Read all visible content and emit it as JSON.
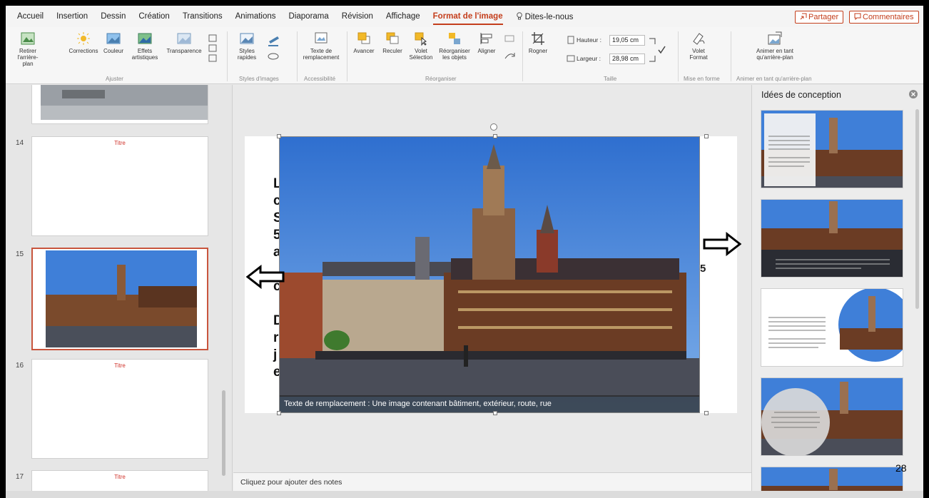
{
  "tabs": [
    "Accueil",
    "Insertion",
    "Dessin",
    "Création",
    "Transitions",
    "Animations",
    "Diaporama",
    "Révision",
    "Affichage",
    "Format de l'image",
    "Dites-le-nous"
  ],
  "active_tab": "Format de l'image",
  "header_buttons": {
    "share": "Partager",
    "comments": "Commentaires"
  },
  "ribbon": {
    "remove_bg": [
      "Retirer",
      "l'arrière-plan"
    ],
    "corrections": "Corrections",
    "color": "Couleur",
    "artistic": [
      "Effets",
      "artistiques"
    ],
    "transparency": "Transparence",
    "group_adjust": "Ajuster",
    "quick_styles": [
      "Styles",
      "rapides"
    ],
    "group_styles": "Styles d'images",
    "alt_text": [
      "Texte de",
      "remplacement"
    ],
    "group_access": "Accessibilité",
    "forward": "Avancer",
    "backward": "Reculer",
    "selection_pane": [
      "Volet",
      "Sélection"
    ],
    "reorder": [
      "Réorganiser",
      "les objets"
    ],
    "align": "Aligner",
    "group_arrange": "Réorganiser",
    "crop": "Rogner",
    "height_label": "Hauteur :",
    "height_value": "19,05 cm",
    "width_label": "Largeur :",
    "width_value": "28,98 cm",
    "group_size": "Taille",
    "format_pane": [
      "Volet",
      "Format"
    ],
    "group_layout": "Mise en forme",
    "animate_bg": [
      "Animer en tant",
      "qu'arrière-plan"
    ],
    "group_animate": "Animer en tant qu'arrière-plan"
  },
  "thumbnails": [
    {
      "number": "14",
      "title": "Titre"
    },
    {
      "number": "15",
      "title": ""
    },
    {
      "number": "16",
      "title": "Titre"
    },
    {
      "number": "17",
      "title": "Titre"
    }
  ],
  "slide": {
    "body_letters": [
      "L",
      "c",
      "S",
      "5",
      "a",
      "",
      "c",
      "",
      "D",
      "r",
      "j",
      "e"
    ],
    "number": "5",
    "alt_text": "Texte de remplacement : Une image contenant bâtiment, extérieur, route, rue"
  },
  "notes_placeholder": "Cliquez pour ajouter des notes",
  "design_pane": {
    "title": "Idées de conception"
  },
  "page_count": "28",
  "colors": {
    "accent": "#c43e1c",
    "sky": "#3f7fd8",
    "building": "#6b3c24"
  }
}
